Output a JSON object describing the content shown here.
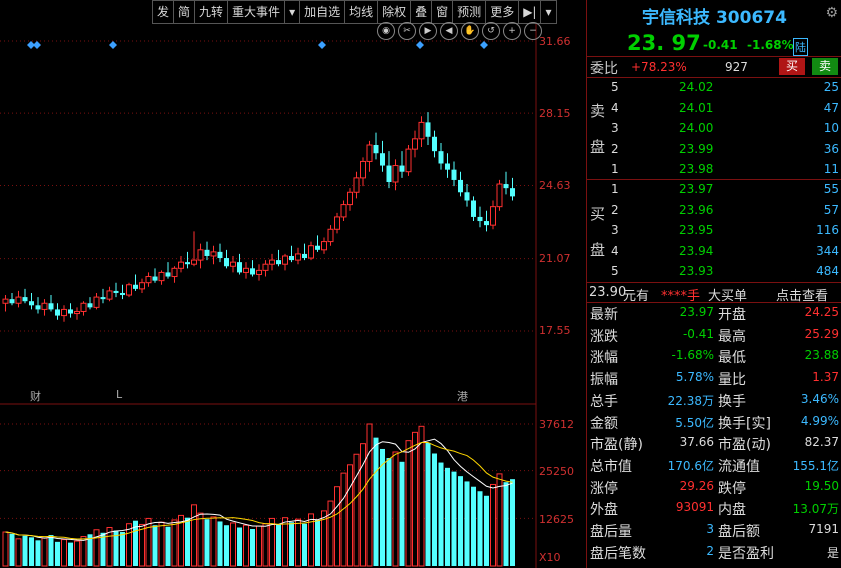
{
  "toolbar": [
    "发",
    "简",
    "九转",
    "重大事件",
    "▾",
    "加自选",
    "均线",
    "除权",
    "叠",
    "窗",
    "预测",
    "更多",
    "▶|",
    "▾"
  ],
  "toolbar_icons": [
    "eye-icon",
    "scissors-icon",
    "play-icon",
    "left-icon",
    "hand-icon",
    "undo-icon",
    "zoom-in-icon",
    "zoom-out-icon"
  ],
  "price_axis": [
    "31.66",
    "28.15",
    "24.63",
    "21.07",
    "17.55"
  ],
  "volume_axis": [
    "37612",
    "25250",
    "12625",
    "X10"
  ],
  "events": {
    "cai": "财",
    "l": "L",
    "gang": "港"
  },
  "chart_data": {
    "type": "candlestick",
    "ylim": [
      17.55,
      31.66
    ],
    "y_ticks": [
      31.66,
      28.15,
      24.63,
      21.07,
      17.55
    ],
    "volume_ticks": [
      37612,
      25250,
      12625
    ],
    "volume_unit": "X10",
    "candles_ohlc": [
      [
        18.9,
        19.3,
        18.5,
        19.1
      ],
      [
        19.1,
        19.4,
        18.8,
        18.9
      ],
      [
        18.9,
        19.5,
        18.7,
        19.2
      ],
      [
        19.2,
        19.6,
        18.9,
        19.0
      ],
      [
        19.0,
        19.4,
        18.6,
        18.8
      ],
      [
        18.8,
        19.2,
        18.4,
        18.6
      ],
      [
        18.6,
        19.1,
        18.3,
        18.9
      ],
      [
        18.9,
        19.3,
        18.5,
        18.6
      ],
      [
        18.6,
        18.9,
        18.1,
        18.3
      ],
      [
        18.3,
        18.8,
        18.0,
        18.6
      ],
      [
        18.6,
        18.9,
        18.2,
        18.4
      ],
      [
        18.4,
        18.7,
        18.1,
        18.5
      ],
      [
        18.5,
        19.0,
        18.3,
        18.9
      ],
      [
        18.9,
        19.2,
        18.6,
        18.7
      ],
      [
        18.7,
        19.4,
        18.6,
        19.2
      ],
      [
        19.2,
        19.6,
        18.9,
        19.1
      ],
      [
        19.1,
        19.7,
        19.0,
        19.5
      ],
      [
        19.5,
        19.9,
        19.2,
        19.4
      ],
      [
        19.4,
        19.8,
        19.1,
        19.3
      ],
      [
        19.3,
        19.9,
        19.2,
        19.8
      ],
      [
        19.8,
        20.3,
        19.5,
        19.6
      ],
      [
        19.6,
        20.1,
        19.4,
        19.9
      ],
      [
        19.9,
        20.4,
        19.7,
        20.2
      ],
      [
        20.2,
        20.6,
        19.9,
        20.0
      ],
      [
        20.0,
        20.5,
        19.8,
        20.4
      ],
      [
        20.4,
        20.9,
        20.1,
        20.2
      ],
      [
        20.2,
        20.7,
        19.9,
        20.6
      ],
      [
        20.6,
        21.2,
        20.4,
        20.9
      ],
      [
        20.9,
        21.4,
        20.6,
        20.8
      ],
      [
        20.8,
        22.4,
        20.7,
        21.0
      ],
      [
        21.0,
        21.8,
        20.6,
        21.5
      ],
      [
        21.5,
        21.9,
        21.0,
        21.2
      ],
      [
        21.2,
        21.7,
        20.8,
        21.4
      ],
      [
        21.4,
        21.8,
        20.9,
        21.1
      ],
      [
        21.1,
        21.5,
        20.6,
        20.7
      ],
      [
        20.7,
        21.2,
        20.4,
        20.9
      ],
      [
        20.9,
        21.3,
        20.3,
        20.4
      ],
      [
        20.4,
        20.9,
        20.1,
        20.6
      ],
      [
        20.6,
        21.0,
        20.2,
        20.3
      ],
      [
        20.3,
        20.8,
        20.0,
        20.5
      ],
      [
        20.5,
        21.0,
        20.2,
        20.8
      ],
      [
        20.8,
        21.3,
        20.5,
        21.0
      ],
      [
        21.0,
        21.5,
        20.7,
        20.8
      ],
      [
        20.8,
        21.3,
        20.5,
        21.2
      ],
      [
        21.2,
        21.7,
        20.9,
        21.0
      ],
      [
        21.0,
        21.6,
        20.8,
        21.3
      ],
      [
        21.3,
        21.8,
        21.0,
        21.1
      ],
      [
        21.1,
        21.9,
        21.0,
        21.7
      ],
      [
        21.7,
        22.2,
        21.4,
        21.5
      ],
      [
        21.5,
        22.1,
        21.3,
        21.9
      ],
      [
        21.9,
        22.7,
        21.7,
        22.5
      ],
      [
        22.5,
        23.3,
        22.3,
        23.1
      ],
      [
        23.1,
        23.9,
        22.9,
        23.7
      ],
      [
        23.7,
        24.5,
        23.4,
        24.3
      ],
      [
        24.3,
        25.3,
        24.0,
        25.0
      ],
      [
        25.0,
        26.0,
        24.6,
        25.8
      ],
      [
        25.8,
        26.8,
        25.3,
        26.6
      ],
      [
        26.6,
        27.2,
        25.9,
        26.2
      ],
      [
        26.2,
        26.8,
        25.3,
        25.6
      ],
      [
        25.6,
        26.3,
        24.5,
        24.8
      ],
      [
        24.8,
        25.9,
        24.4,
        25.6
      ],
      [
        25.6,
        26.3,
        25.0,
        25.3
      ],
      [
        25.3,
        26.6,
        25.1,
        26.4
      ],
      [
        26.4,
        27.3,
        26.0,
        26.9
      ],
      [
        26.9,
        28.0,
        26.5,
        27.7
      ],
      [
        27.7,
        28.2,
        26.6,
        27.0
      ],
      [
        27.0,
        27.3,
        26.0,
        26.3
      ],
      [
        26.3,
        26.7,
        25.4,
        25.7
      ],
      [
        25.7,
        26.2,
        25.0,
        25.4
      ],
      [
        25.4,
        25.8,
        24.6,
        24.9
      ],
      [
        24.9,
        25.3,
        24.1,
        24.3
      ],
      [
        24.3,
        24.7,
        23.6,
        23.9
      ],
      [
        23.9,
        24.1,
        22.9,
        23.1
      ],
      [
        23.1,
        23.6,
        22.6,
        22.9
      ],
      [
        22.9,
        23.4,
        22.4,
        22.7
      ],
      [
        22.7,
        23.9,
        22.5,
        23.6
      ],
      [
        23.6,
        24.9,
        23.4,
        24.7
      ],
      [
        24.7,
        25.3,
        24.2,
        24.5
      ],
      [
        24.5,
        25.0,
        23.9,
        24.1
      ]
    ],
    "volumes": [
      9000,
      8500,
      7200,
      8000,
      7600,
      6800,
      7400,
      8200,
      6400,
      7000,
      6200,
      6600,
      7800,
      8400,
      9600,
      8800,
      10200,
      9400,
      9000,
      11200,
      12000,
      11000,
      12600,
      10800,
      11600,
      10400,
      12200,
      13400,
      12800,
      16200,
      14000,
      12400,
      13000,
      11800,
      10800,
      11400,
      10200,
      10800,
      9800,
      10600,
      11200,
      12600,
      11000,
      12800,
      11600,
      12400,
      11200,
      13800,
      12200,
      14600,
      17200,
      21000,
      24600,
      26800,
      29600,
      32400,
      37612,
      34000,
      31000,
      28600,
      30200,
      27600,
      33200,
      35400,
      37000,
      32600,
      29800,
      27400,
      26000,
      25000,
      23800,
      22400,
      21000,
      19800,
      18600,
      21600,
      24400,
      22200,
      23000
    ]
  },
  "panel": {
    "name": "宇信科技",
    "code": "300674",
    "price": "23. 97",
    "change": "-0.41",
    "change_pct": "-1.68%",
    "board": "陆",
    "wb_label": "委比",
    "wb_value": "+78.23%",
    "wb_count": "927",
    "buy_btn": "买",
    "sell_btn": "卖",
    "sell_label": [
      "卖",
      "盘"
    ],
    "buy_label": [
      "买",
      "盘"
    ],
    "asks": [
      {
        "lvl": "5",
        "price": "24.02",
        "vol": "25"
      },
      {
        "lvl": "4",
        "price": "24.01",
        "vol": "47"
      },
      {
        "lvl": "3",
        "price": "24.00",
        "vol": "10"
      },
      {
        "lvl": "2",
        "price": "23.99",
        "vol": "36"
      },
      {
        "lvl": "1",
        "price": "23.98",
        "vol": "11"
      }
    ],
    "bids": [
      {
        "lvl": "1",
        "price": "23.97",
        "vol": "55"
      },
      {
        "lvl": "2",
        "price": "23.96",
        "vol": "57"
      },
      {
        "lvl": "3",
        "price": "23.95",
        "vol": "116"
      },
      {
        "lvl": "4",
        "price": "23.94",
        "vol": "344"
      },
      {
        "lvl": "5",
        "price": "23.93",
        "vol": "484"
      }
    ],
    "bigbuy": {
      "price": "23.90",
      "yuan": "元有",
      "stars": "****手",
      "label": "大买单",
      "link": "点击查看"
    },
    "stats": [
      {
        "l": "最新",
        "v": "23.97",
        "vc": "grn",
        "l2": "开盘",
        "v2": "24.25",
        "v2c": "red"
      },
      {
        "l": "涨跌",
        "v": "-0.41",
        "vc": "grn",
        "l2": "最高",
        "v2": "25.29",
        "v2c": "red"
      },
      {
        "l": "涨幅",
        "v": "-1.68%",
        "vc": "grn",
        "l2": "最低",
        "v2": "23.88",
        "v2c": "grn"
      },
      {
        "l": "振幅",
        "v": "5.78%",
        "vc": "cyn",
        "l2": "量比",
        "v2": "1.37",
        "v2c": "red"
      },
      {
        "l": "总手",
        "v": "22.38万",
        "vc": "cyn",
        "l2": "换手",
        "v2": "3.46%",
        "v2c": "cyn"
      },
      {
        "l": "金额",
        "v": "5.50亿",
        "vc": "cyn",
        "l2": "换手[实]",
        "v2": "4.99%",
        "v2c": "cyn"
      },
      {
        "l": "市盈(静)",
        "v": "37.66",
        "vc": "wht",
        "l2": "市盈(动)",
        "v2": "82.37",
        "v2c": "wht"
      },
      {
        "l": "总市值",
        "v": "170.6亿",
        "vc": "cyn",
        "l2": "流通值",
        "v2": "155.1亿",
        "v2c": "cyn"
      },
      {
        "l": "涨停",
        "v": "29.26",
        "vc": "red",
        "l2": "跌停",
        "v2": "19.50",
        "v2c": "grn"
      },
      {
        "l": "外盘",
        "v": "93091",
        "vc": "red",
        "l2": "内盘",
        "v2": "13.07万",
        "v2c": "grn"
      },
      {
        "l": "盘后量",
        "v": "3",
        "vc": "cyn",
        "l2": "盘后额",
        "v2": "7191",
        "v2c": "wht"
      },
      {
        "l": "盘后笔数",
        "v": "2",
        "vc": "cyn",
        "l2": "是否盈利",
        "v2": "是",
        "v2c": "wht"
      }
    ]
  }
}
